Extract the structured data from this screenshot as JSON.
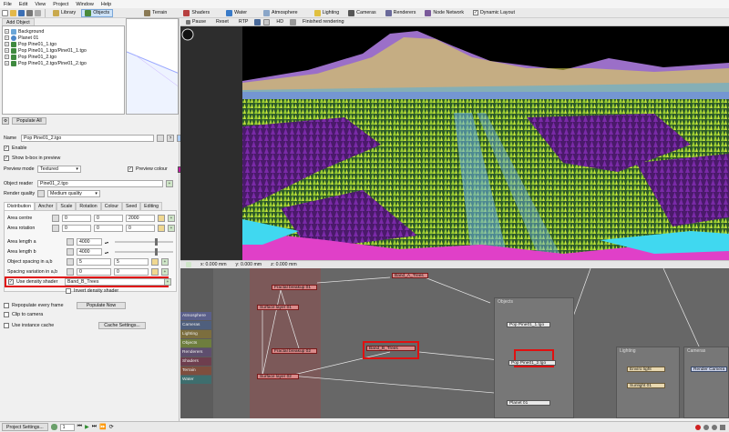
{
  "menu": [
    "File",
    "Edit",
    "View",
    "Project",
    "Window",
    "Help"
  ],
  "toolbar": {
    "library": "Library",
    "objects": "Objects",
    "terrain": "Terrain",
    "shaders": "Shaders",
    "water": "Water",
    "atmosphere": "Atmosphere",
    "lighting": "Lighting",
    "cameras": "Cameras",
    "renderers": "Renderers",
    "node_network": "Node Network",
    "dynamic_layout": "Dynamic Layout"
  },
  "objects_panel": {
    "add_object": "Add Object",
    "tree": [
      "Background",
      "Planet 01",
      "Pop Pine01_1.tgo",
      "Pop Pine01_1.tgo/Pine01_1.tgo",
      "Pop Pine01_2.tgo",
      "Pop Pine01_2.tgo/Pine01_2.tgo"
    ],
    "populate_all": "Populate All"
  },
  "props": {
    "name_label": "Name",
    "name_value": "Pop Pine01_2.tgo",
    "enable": "Enable",
    "show_bbox": "Show b-box in preview",
    "preview_mode_label": "Preview mode",
    "preview_mode_value": "Textured",
    "preview_colour": "Preview colour",
    "object_reader_label": "Object reader",
    "object_reader_value": "Pine01_2.tgo",
    "render_quality_label": "Render quality",
    "render_quality_value": "Medium quality",
    "tabs": [
      "Distribution",
      "Anchor",
      "Scale",
      "Rotation",
      "Colour",
      "Seed",
      "Editing"
    ],
    "area_centre": "Area centre",
    "area_centre_vals": [
      "0",
      "0",
      "2000"
    ],
    "area_rotation": "Area rotation",
    "area_rotation_vals": [
      "0",
      "0",
      "0"
    ],
    "area_length_a": "Area length a",
    "area_length_a_val": "4000",
    "area_length_b": "Area length b",
    "area_length_b_val": "4000",
    "object_spacing": "Object spacing in a,b",
    "object_spacing_vals": [
      "5",
      "5"
    ],
    "spacing_variation": "Spacing variation in a,b",
    "spacing_variation_vals": [
      "0",
      "0"
    ],
    "use_density_shader": "Use density shader",
    "density_shader_value": "Band_B_Trees",
    "invert_density_shader": "Invert density shader",
    "repopulate": "Repopulate every frame",
    "populate_now": "Populate Now",
    "clip_camera": "Clip to camera",
    "use_instance_cache": "Use instance cache",
    "cache_settings": "Cache Settings..."
  },
  "view_toolbar": {
    "pause": "Pause",
    "reset": "Reset",
    "rtp": "RTP",
    "hd": "HD",
    "status": "Finished rendering"
  },
  "coords": [
    "x: 0.000 mm",
    "y: 0.000 mm",
    "z: 0.000 mm"
  ],
  "node_network": {
    "categories": [
      "Atmosphere",
      "Cameras",
      "Lighting",
      "Objects",
      "Renderers",
      "Shaders",
      "Terrain",
      "Water"
    ],
    "category_colors": [
      "#5a5f8a",
      "#4f5f7d",
      "#7c6e3e",
      "#6e7e3e",
      "#5e4e6e",
      "#6e3e4e",
      "#7e4e3e",
      "#3e6e6e"
    ],
    "nodes": {
      "band_a": "Band_A_Trees",
      "band_b": "Band_B_Trees",
      "fractal_1": "Fractal breakup 01",
      "fractal_2": "Fractal breakup 02",
      "surface_1": "Surface layer 01",
      "surface_2": "Surface layer 02",
      "pop_pine": "Pop Pine01_1.tgo",
      "pop_pine_2": "Pop Pine01_2.tgo",
      "planet": "Planet 01",
      "groups": {
        "objects": "Objects",
        "lighting": "Lighting",
        "cameras": "Cameras"
      },
      "sunlight": "Sunlight 01",
      "enviro": "Enviro light",
      "render_camera": "Render Camera"
    }
  },
  "statusbar": {
    "project_settings": "Project Settings...",
    "frame": "1"
  }
}
